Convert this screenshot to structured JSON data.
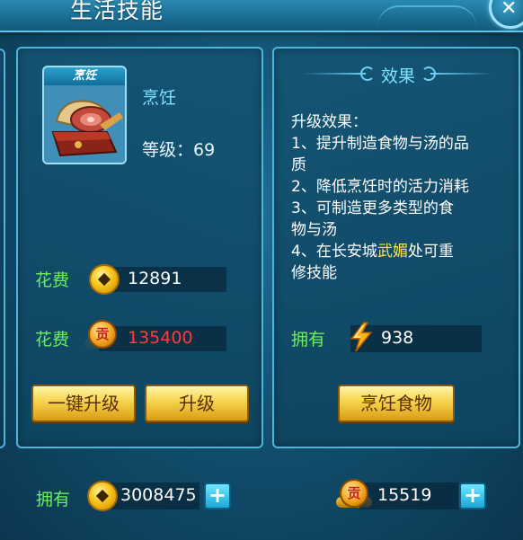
{
  "window": {
    "title": "生活技能"
  },
  "skill": {
    "icon_tag": "烹饪",
    "name": "烹饪",
    "level_text": "等级：69"
  },
  "costs": [
    {
      "label": "花费",
      "currency": "gold-coin",
      "value": "12891",
      "color": "#ffffff"
    },
    {
      "label": "花费",
      "currency": "contribution-medal",
      "value": "135400",
      "color": "#ff3b3b"
    }
  ],
  "buttons": {
    "upgrade_all": "一键升级",
    "upgrade": "升级",
    "cook": "烹饪食物"
  },
  "effect": {
    "title": "效果",
    "lines": [
      "升级效果：",
      "1、提升制造食物与汤的品",
      "质",
      "2、降低烹饪时的活力消耗",
      "3、可制造更多类型的食",
      "物与汤"
    ],
    "line4_prefix": "4、在长安城",
    "line4_highlight": "武媚",
    "line4_suffix": "处可重",
    "line5": "修技能",
    "highlight_color": "#ffe14a"
  },
  "owned_energy": {
    "label": "拥有",
    "icon": "energy-bolt-icon",
    "value": "938"
  },
  "footer": {
    "label": "拥有",
    "gold_value": "3008475",
    "contribution_value": "15519",
    "plus_symbol": "+"
  },
  "medal_glyph": "贡",
  "close_symbol": "✕"
}
